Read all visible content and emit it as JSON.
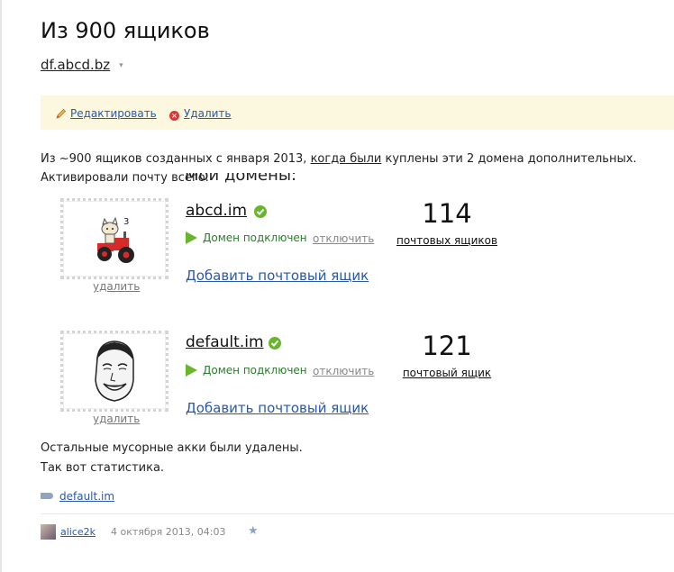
{
  "post": {
    "title": "Из 900 ящиков",
    "blog": "df.abcd.bz",
    "caret": "▾"
  },
  "toolbar": {
    "edit_label": "Редактировать",
    "delete_label": "Удалить"
  },
  "intro": {
    "before_link": "Из ~900 ящиков созданных с января 2013, ",
    "link_text": "когда были",
    "after_link": " куплены эти 2 домена дополнительных.",
    "line2": "Активировали почту всего.",
    "cut_heading": "Мои домены:"
  },
  "domains": [
    {
      "name": "abcd.im",
      "status": "Домен подключен",
      "disconnect": "отключить",
      "add_box": "Добавить почтовый ящик",
      "remove": "удалить",
      "count": "114",
      "count_label": "почтовых ящиков",
      "logo": "tractor-cat-icon"
    },
    {
      "name": "default.im",
      "status": "Домен подключен",
      "disconnect": "отключить",
      "add_box": "Добавить почтовый ящик",
      "remove": "удалить",
      "count": "121",
      "count_label": "почтовый ящик",
      "logo": "meme-face-icon"
    }
  ],
  "outro": {
    "line1": "Остальные мусорные акки были удалены.",
    "line2": "Так вот статистика."
  },
  "tags": [
    "default.im"
  ],
  "footer": {
    "author": "alice2k",
    "date": "4 октября 2013, 04:03",
    "star": "★"
  },
  "colors": {
    "link": "#2b58a8",
    "toolbar_bg": "#fcf8e0",
    "status_green": "#2a7d2a",
    "verified_green": "#6ab52e"
  }
}
